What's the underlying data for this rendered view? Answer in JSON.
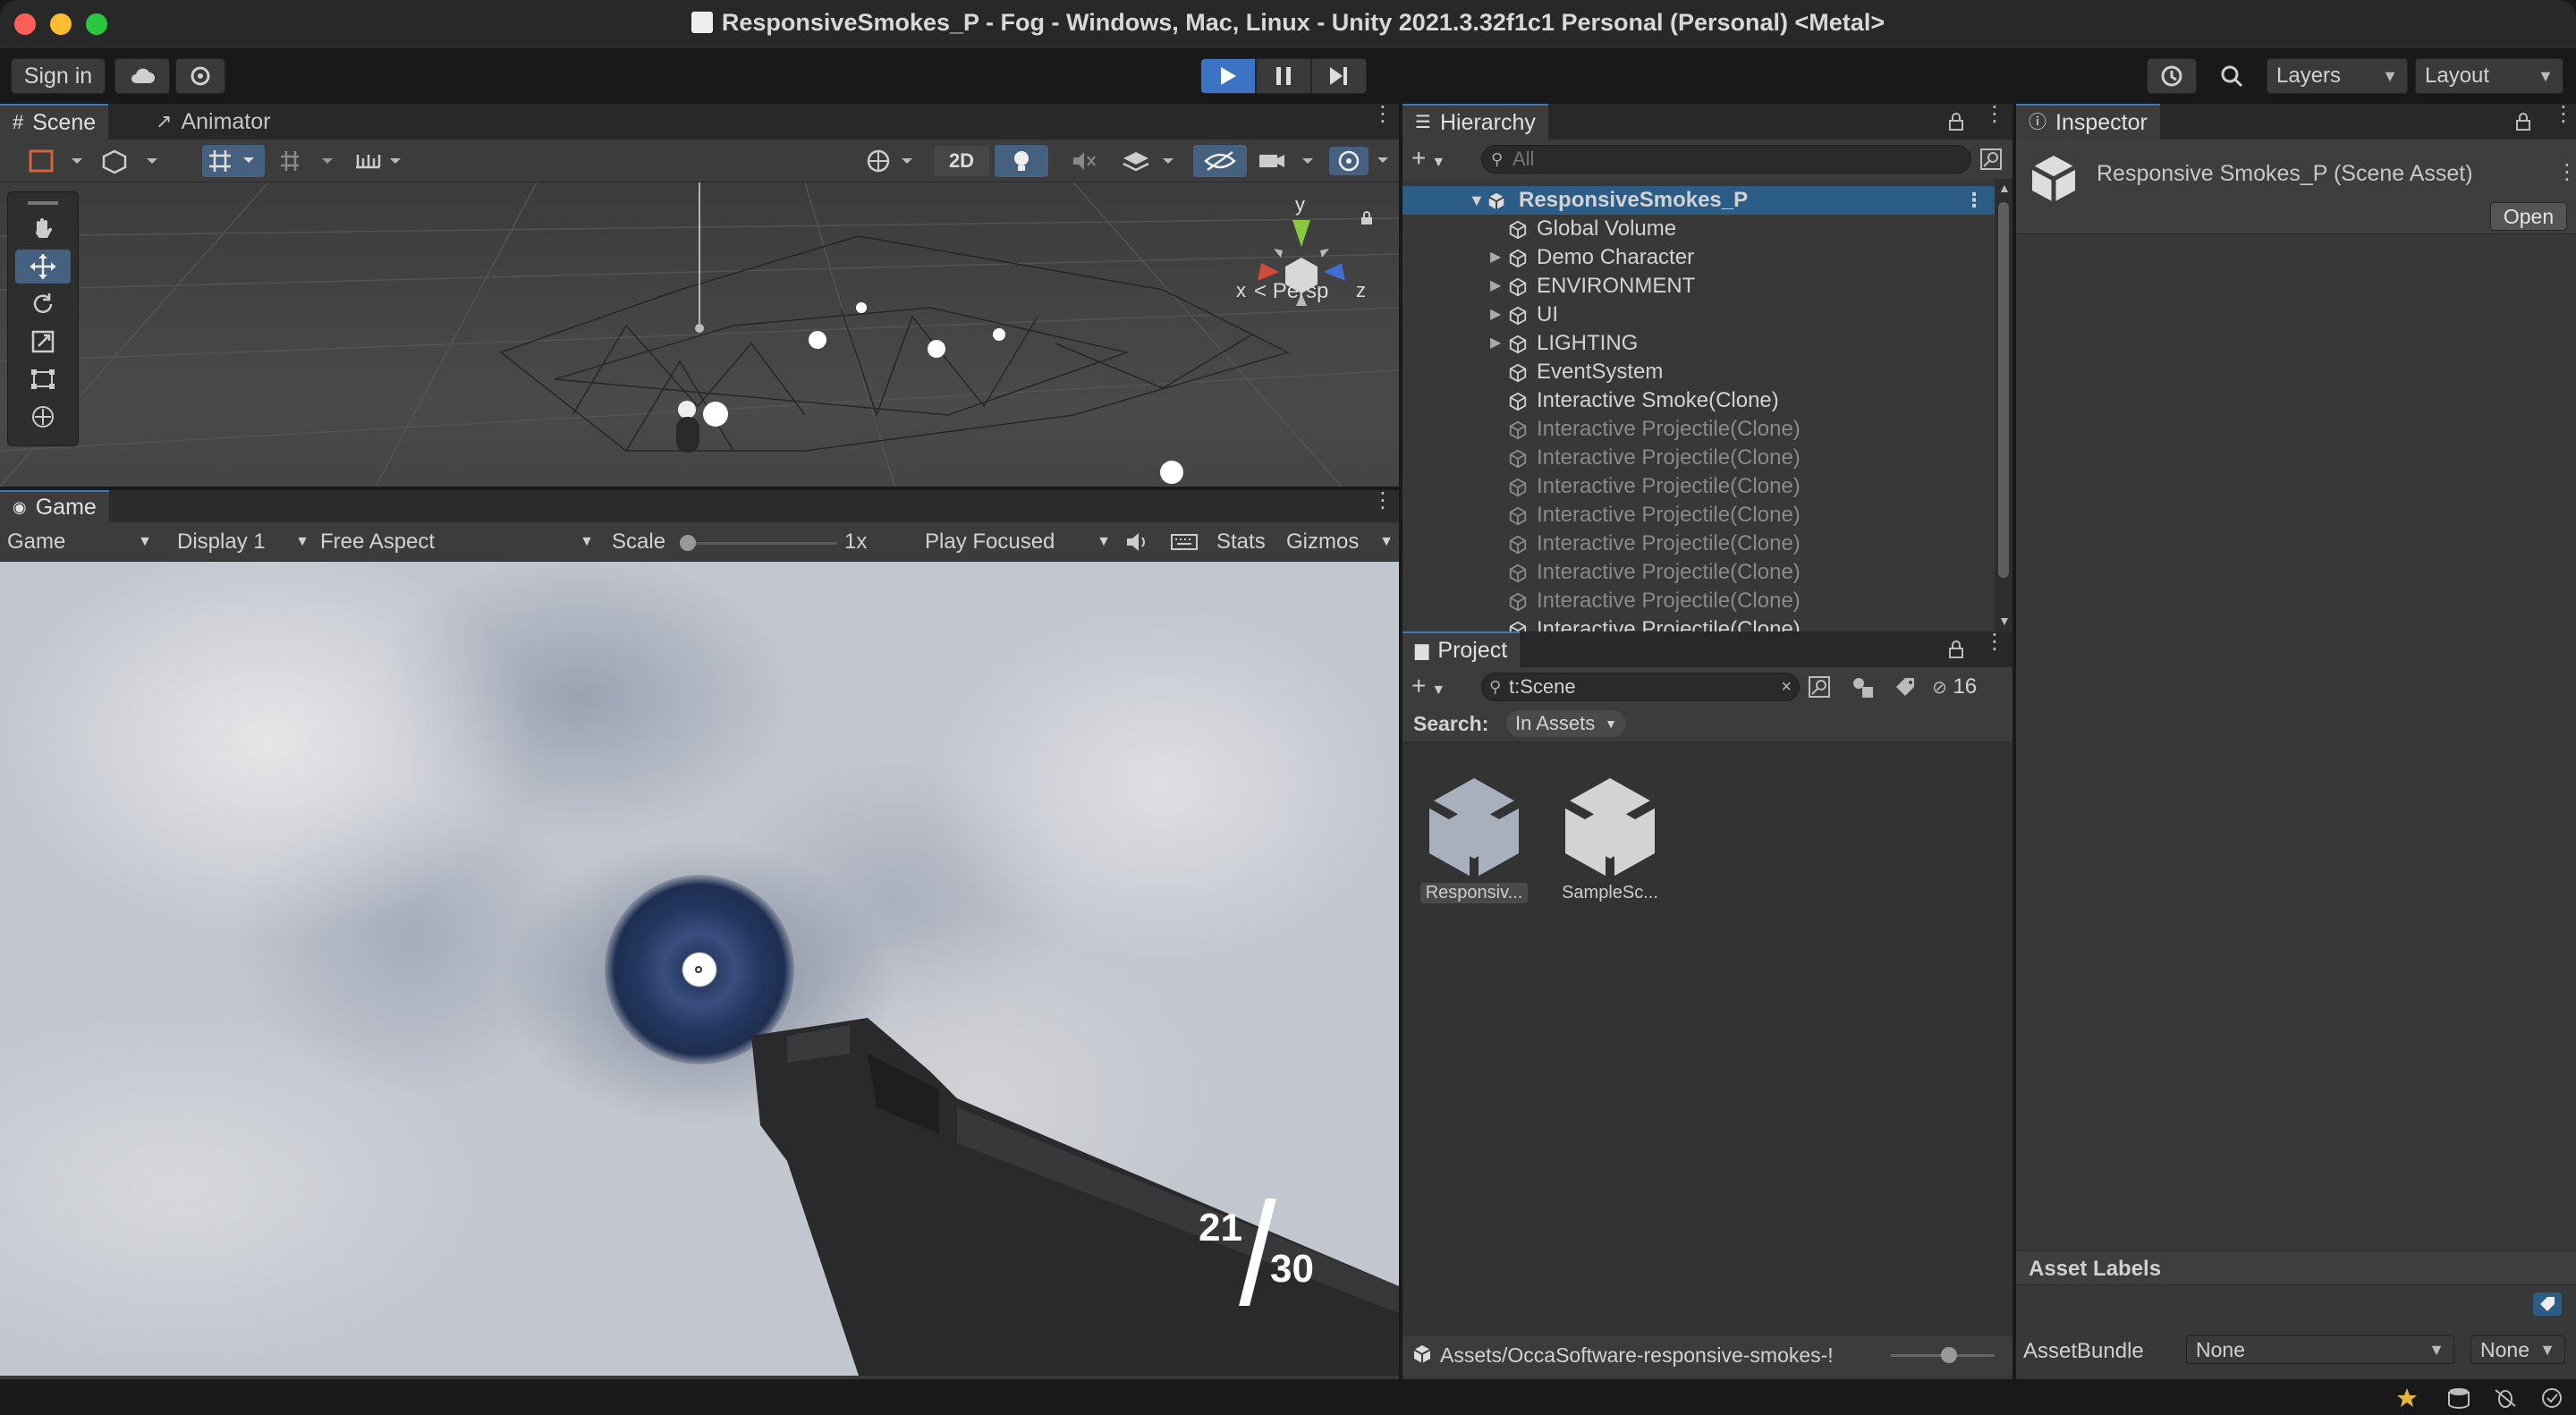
{
  "window": {
    "title": "ResponsiveSmokes_P - Fog - Windows, Mac, Linux - Unity 2021.3.32f1c1 Personal (Personal) <Metal>"
  },
  "toolbar": {
    "sign_in": "Sign in",
    "layers": "Layers",
    "layout": "Layout"
  },
  "scene": {
    "tab_scene": "Scene",
    "tab_animator": "Animator",
    "btn_2d": "2D",
    "persp": "Persp",
    "axis_x": "x",
    "axis_y": "y",
    "axis_z": "z"
  },
  "game": {
    "tab_game": "Game",
    "view_select": "Game",
    "display": "Display 1",
    "aspect": "Free Aspect",
    "scale_label": "Scale",
    "scale_value": "1x",
    "play_mode": "Play Focused",
    "stats": "Stats",
    "gizmos": "Gizmos",
    "ammo_current": "21",
    "ammo_total": "30"
  },
  "hierarchy": {
    "tab": "Hierarchy",
    "search_placeholder": "All",
    "root": "ResponsiveSmokes_P",
    "items": [
      {
        "label": "Global Volume",
        "dim": false,
        "expandable": false
      },
      {
        "label": "Demo Character",
        "dim": false,
        "expandable": true
      },
      {
        "label": "ENVIRONMENT",
        "dim": false,
        "expandable": true
      },
      {
        "label": "UI",
        "dim": false,
        "expandable": true
      },
      {
        "label": "LIGHTING",
        "dim": false,
        "expandable": true
      },
      {
        "label": "EventSystem",
        "dim": false,
        "expandable": false
      },
      {
        "label": "Interactive Smoke(Clone)",
        "dim": false,
        "expandable": false
      },
      {
        "label": "Interactive Projectile(Clone)",
        "dim": true,
        "expandable": false
      },
      {
        "label": "Interactive Projectile(Clone)",
        "dim": true,
        "expandable": false
      },
      {
        "label": "Interactive Projectile(Clone)",
        "dim": true,
        "expandable": false
      },
      {
        "label": "Interactive Projectile(Clone)",
        "dim": true,
        "expandable": false
      },
      {
        "label": "Interactive Projectile(Clone)",
        "dim": true,
        "expandable": false
      },
      {
        "label": "Interactive Projectile(Clone)",
        "dim": true,
        "expandable": false
      },
      {
        "label": "Interactive Projectile(Clone)",
        "dim": true,
        "expandable": false
      },
      {
        "label": "Interactive Projectile(Clone)",
        "dim": false,
        "expandable": false
      }
    ]
  },
  "project": {
    "tab": "Project",
    "search_value": "t:Scene",
    "hidden_count": "16",
    "search_label": "Search:",
    "search_scope": "In Assets",
    "assets": [
      {
        "label": "Responsiv..."
      },
      {
        "label": "SampleSc..."
      }
    ],
    "path": "Assets/OccaSoftware-responsive-smokes-!"
  },
  "inspector": {
    "tab": "Inspector",
    "asset_title": "Responsive Smokes_P (Scene Asset)",
    "open_button": "Open",
    "asset_labels": "Asset Labels",
    "asset_bundle_label": "AssetBundle",
    "asset_bundle_value": "None",
    "asset_variant_value": "None"
  },
  "colors": {
    "accent": "#3d73c4",
    "selection": "#2c5d87",
    "panel": "#383838"
  }
}
